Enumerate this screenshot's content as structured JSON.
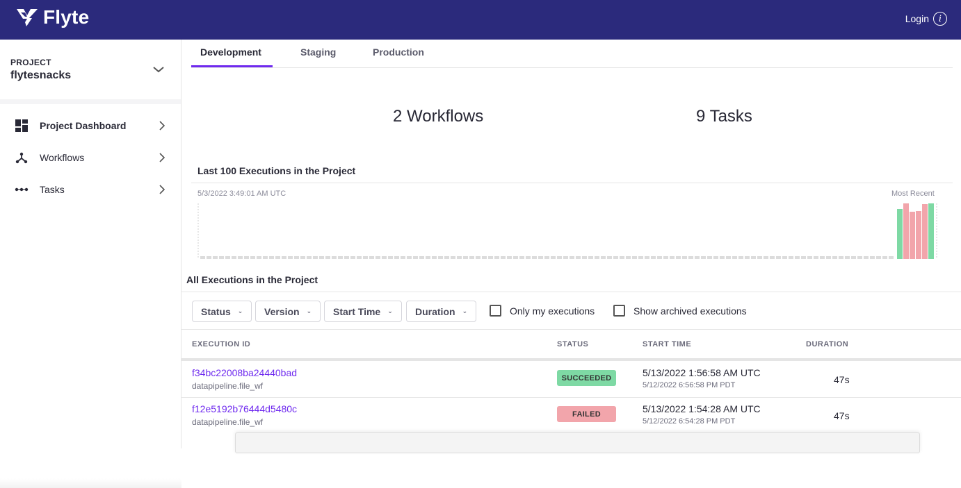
{
  "header": {
    "logo_text": "Flyte",
    "login_label": "Login",
    "info_glyph": "i",
    "bar_color": "#2b2a7c"
  },
  "sidebar": {
    "project_label": "PROJECT",
    "project_name": "flytesnacks",
    "items": [
      {
        "label": "Project Dashboard",
        "icon": "dashboard-icon",
        "active": true
      },
      {
        "label": "Workflows",
        "icon": "workflow-icon",
        "active": false
      },
      {
        "label": "Tasks",
        "icon": "task-icon",
        "active": false
      }
    ]
  },
  "tabs": [
    {
      "label": "Development",
      "active": true
    },
    {
      "label": "Staging",
      "active": false
    },
    {
      "label": "Production",
      "active": false
    }
  ],
  "stats": {
    "workflows": "2 Workflows",
    "tasks": "9 Tasks"
  },
  "chart": {
    "title": "Last 100 Executions in the Project",
    "start_label": "5/3/2022 3:49:01 AM UTC",
    "end_label": "Most Recent",
    "colors": {
      "succeeded": "#7ed9a4",
      "failed": "#f2a5ab",
      "empty": "#dcdcdc"
    },
    "chart_data": {
      "type": "bar",
      "bars": [
        {
          "status": "succeeded",
          "value": 0.9
        },
        {
          "status": "failed",
          "value": 1.0
        },
        {
          "status": "failed",
          "value": 0.85
        },
        {
          "status": "failed",
          "value": 0.86
        },
        {
          "status": "failed",
          "value": 0.99
        },
        {
          "status": "succeeded",
          "value": 1.0
        }
      ]
    }
  },
  "executions": {
    "title": "All Executions in the Project",
    "filters": [
      "Status",
      "Version",
      "Start Time",
      "Duration"
    ],
    "checkboxes": [
      "Only my executions",
      "Show archived executions"
    ],
    "columns": [
      "EXECUTION ID",
      "STATUS",
      "START TIME",
      "DURATION"
    ],
    "rows": [
      {
        "id": "f34bc22008ba24440bad",
        "workflow": "datapipeline.file_wf",
        "status": "SUCCEEDED",
        "status_kind": "succeeded",
        "start_utc": "5/13/2022 1:56:58 AM UTC",
        "start_local": "5/12/2022 6:56:58 PM PDT",
        "duration": "47s"
      },
      {
        "id": "f12e5192b76444d5480c",
        "workflow": "datapipeline.file_wf",
        "status": "FAILED",
        "status_kind": "failed",
        "start_utc": "5/13/2022 1:54:28 AM UTC",
        "start_local": "5/12/2022 6:54:28 PM PDT",
        "duration": "47s"
      }
    ]
  }
}
